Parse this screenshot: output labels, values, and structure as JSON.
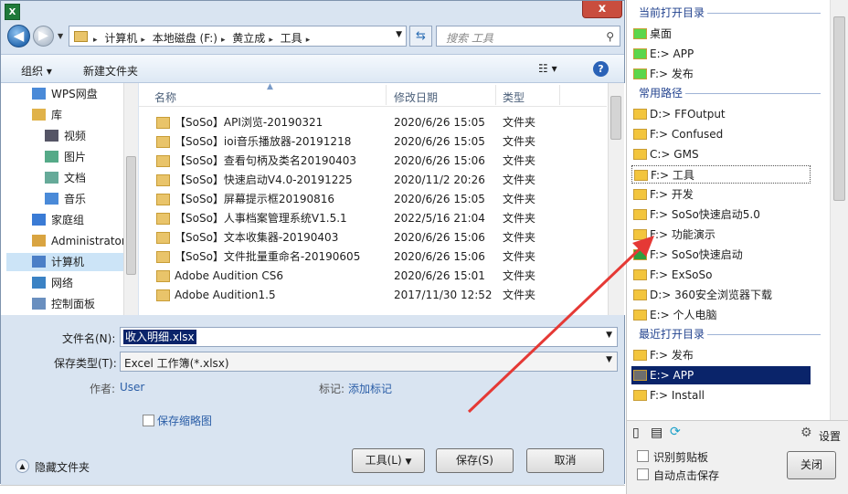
{
  "dialog": {
    "close_glyph": "x",
    "address": {
      "crumbs": [
        "计算机",
        "本地磁盘 (F:)",
        "黄立成",
        "工具"
      ]
    },
    "search_placeholder": "搜索 工具",
    "toolbar": {
      "organize": "组织 ▾",
      "new_folder": "新建文件夹"
    },
    "nav_items": [
      {
        "label": "WPS网盘",
        "icon": "cloud-icon"
      },
      {
        "label": "库",
        "icon": "library-icon"
      },
      {
        "label": "视频",
        "icon": "video-icon"
      },
      {
        "label": "图片",
        "icon": "picture-icon"
      },
      {
        "label": "文档",
        "icon": "document-icon"
      },
      {
        "label": "音乐",
        "icon": "music-icon"
      },
      {
        "label": "家庭组",
        "icon": "homegroup-icon"
      },
      {
        "label": "Administrator",
        "icon": "user-icon"
      },
      {
        "label": "计算机",
        "icon": "computer-icon"
      },
      {
        "label": "网络",
        "icon": "network-icon"
      },
      {
        "label": "控制面板",
        "icon": "control-panel-icon"
      }
    ],
    "columns": {
      "name": "名称",
      "date": "修改日期",
      "type": "类型"
    },
    "files": [
      {
        "name": "【SoSo】API浏览-20190321",
        "date": "2020/6/26 15:05",
        "type": "文件夹"
      },
      {
        "name": "【SoSo】ioi音乐播放器-20191218",
        "date": "2020/6/26 15:05",
        "type": "文件夹"
      },
      {
        "name": "【SoSo】查看句柄及类名20190403",
        "date": "2020/6/26 15:06",
        "type": "文件夹"
      },
      {
        "name": "【SoSo】快速启动V4.0-20191225",
        "date": "2020/11/2 20:26",
        "type": "文件夹"
      },
      {
        "name": "【SoSo】屏幕提示框20190816",
        "date": "2020/6/26 15:05",
        "type": "文件夹"
      },
      {
        "name": "【SoSo】人事档案管理系统V1.5.1",
        "date": "2022/5/16 21:04",
        "type": "文件夹"
      },
      {
        "name": "【SoSo】文本收集器-20190403",
        "date": "2020/6/26 15:06",
        "type": "文件夹"
      },
      {
        "name": "【SoSo】文件批量重命名-20190605",
        "date": "2020/6/26 15:06",
        "type": "文件夹"
      },
      {
        "name": "Adobe Audition CS6",
        "date": "2020/6/26 15:01",
        "type": "文件夹"
      },
      {
        "name": "Adobe Audition1.5",
        "date": "2017/11/30 12:52",
        "type": "文件夹"
      }
    ],
    "filename_label": "文件名(N):",
    "filename_value": "收入明细.xlsx",
    "savetype_label": "保存类型(T):",
    "savetype_value": "Excel 工作簿(*.xlsx)",
    "author_label": "作者:",
    "author_value": "User",
    "tags_label": "标记:",
    "tags_value": "添加标记",
    "save_thumbnail": "保存缩略图",
    "hide_folders": "隐藏文件夹",
    "tools_button": "工具(L)",
    "save_button": "保存(S)",
    "cancel_button": "取消"
  },
  "side_panel": {
    "sections": [
      {
        "title": "当前打开目录",
        "items": [
          {
            "label": "桌面",
            "color": "#5cd64b"
          },
          {
            "label": "E:> APP",
            "color": "#5cd64b"
          },
          {
            "label": "F:> 发布",
            "color": "#5cd64b"
          }
        ]
      },
      {
        "title": "常用路径",
        "items": [
          {
            "label": "D:> FFOutput",
            "color": "#f3c53d"
          },
          {
            "label": "F:> Confused",
            "color": "#f3c53d"
          },
          {
            "label": "C:> GMS",
            "color": "#f3c53d"
          },
          {
            "label": "F:> 工具",
            "color": "#f3c53d"
          },
          {
            "label": "F:> 开发",
            "color": "#f3c53d"
          },
          {
            "label": "F:> SoSo快速启动5.0",
            "color": "#f3c53d"
          },
          {
            "label": "F:> 功能演示",
            "color": "#f3c53d"
          },
          {
            "label": "F:> SoSo快速启动",
            "color": "#2e9e3e"
          },
          {
            "label": "F:> ExSoSo",
            "color": "#f3c53d"
          },
          {
            "label": "D:> 360安全浏览器下载",
            "color": "#f3c53d"
          },
          {
            "label": "E:> 个人电脑",
            "color": "#f3c53d"
          }
        ]
      },
      {
        "title": "最近打开目录",
        "items": [
          {
            "label": "F:> 发布",
            "color": "#f3c53d"
          },
          {
            "label": "E:> APP",
            "color": "#6e6e6e"
          },
          {
            "label": "F:> Install",
            "color": "#f3c53d"
          }
        ]
      }
    ],
    "settings": "设置",
    "clipboard_label": "识别剪贴板",
    "autosave_label": "自动点击保存",
    "close_button": "关闭"
  },
  "colors": {
    "highlight": "#0a246a",
    "accent": "#23438f",
    "arrow": "#e53935"
  }
}
